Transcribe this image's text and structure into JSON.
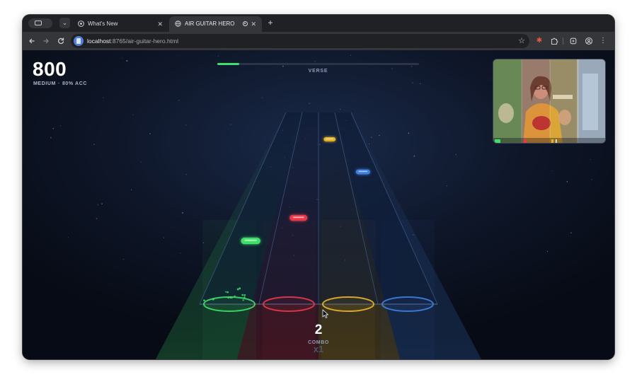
{
  "browser": {
    "tabs": [
      {
        "title": "What's New",
        "close": "✕",
        "active": false
      },
      {
        "title": "AIR GUITAR HERO",
        "close": "✕",
        "active": true
      }
    ],
    "new_tab": "+",
    "url_host": "localhost",
    "url_path": ":8765/air-guitar-hero.html",
    "icons": {
      "back": "arrow-left-icon",
      "forward": "arrow-right-icon",
      "reload": "reload-icon",
      "bookmark": "star-icon",
      "extension_1": "bug-icon",
      "extensions": "puzzle-icon",
      "extension_3": "shield-icon",
      "profile": "profile-icon",
      "menu": "kebab-menu-icon"
    }
  },
  "game": {
    "score": "800",
    "difficulty": "MEDIUM",
    "separator": "·",
    "accuracy": "80% ACC",
    "song_progress": 0.11,
    "section": "VERSE",
    "combo": "2",
    "combo_label": "COMBO",
    "multiplier": "x1",
    "lane_colors": [
      "#3fe06a",
      "#e8394a",
      "#e8b52a",
      "#3f7fe0"
    ],
    "notes": [
      {
        "lane": 0,
        "depth": 0.67
      },
      {
        "lane": 1,
        "depth": 0.55
      },
      {
        "lane": 2,
        "depth": 0.14
      },
      {
        "lane": 3,
        "depth": 0.31
      }
    ]
  },
  "webcam": {
    "lane_tints": [
      "#3fe06a",
      "#e8394a",
      "#e8b52a",
      "#3f7fe0"
    ]
  }
}
